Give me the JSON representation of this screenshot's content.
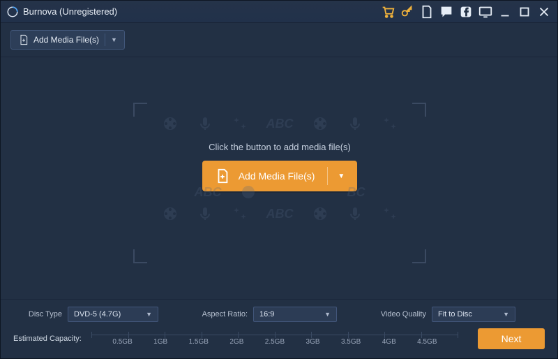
{
  "window": {
    "title": "Burnova (Unregistered)"
  },
  "toolbar": {
    "addFiles": "Add Media File(s)"
  },
  "center": {
    "prompt": "Click the button to add media file(s)",
    "addButton": "Add Media File(s)",
    "ghostText": "ABC"
  },
  "bottom": {
    "discType": {
      "label": "Disc Type",
      "value": "DVD-5 (4.7G)"
    },
    "aspectRatio": {
      "label": "Aspect Ratio:",
      "value": "16:9"
    },
    "videoQuality": {
      "label": "Video Quality",
      "value": "Fit to Disc"
    },
    "capacity": {
      "label": "Estimated Capacity:",
      "ticks": [
        "",
        "0.5GB",
        "1GB",
        "1.5GB",
        "2GB",
        "2.5GB",
        "3GB",
        "3.5GB",
        "4GB",
        "4.5GB",
        ""
      ]
    },
    "next": "Next"
  }
}
